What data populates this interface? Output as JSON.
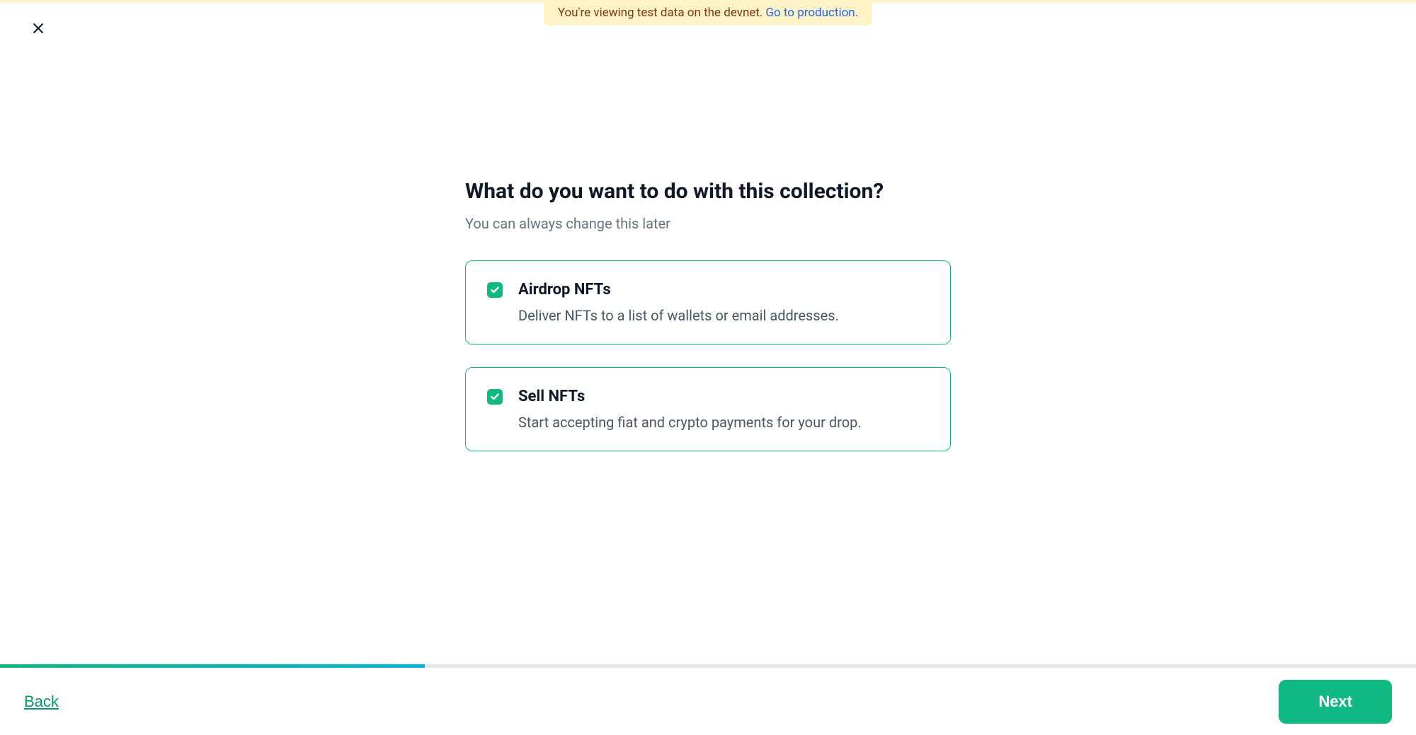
{
  "notice": {
    "text": "You're viewing test data on the devnet.",
    "linkText": "Go to production."
  },
  "main": {
    "heading": "What do you want to do with this collection?",
    "subheading": "You can always change this later",
    "options": [
      {
        "title": "Airdrop NFTs",
        "desc": "Deliver NFTs to a list of wallets or email addresses.",
        "checked": true
      },
      {
        "title": "Sell NFTs",
        "desc": "Start accepting fiat and crypto payments for your drop.",
        "checked": true
      }
    ]
  },
  "progress": {
    "percent": 30
  },
  "footer": {
    "backLabel": "Back",
    "nextLabel": "Next"
  }
}
